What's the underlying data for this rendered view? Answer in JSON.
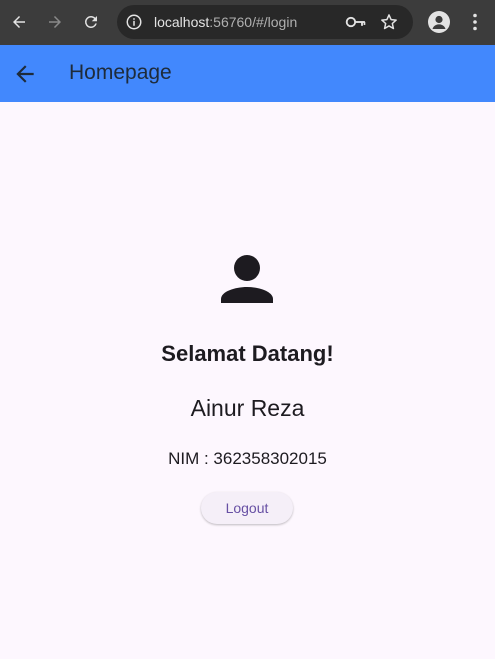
{
  "browser": {
    "url_host": "localhost",
    "url_rest": ":56760/#/login",
    "icons": {
      "back": "back-arrow-icon",
      "forward": "forward-arrow-icon",
      "reload": "reload-icon",
      "site_info": "info-icon",
      "password": "key-icon",
      "bookmark": "star-icon",
      "profile": "profile-icon",
      "menu": "more-vert-icon"
    }
  },
  "appbar": {
    "title": "Homepage",
    "back_icon": "back-arrow-icon",
    "color": "#4288fd"
  },
  "profile": {
    "icon": "person-icon",
    "welcome": "Selamat Datang!",
    "name": "Ainur Reza",
    "nim": "NIM : 362358302015"
  },
  "actions": {
    "logout_label": "Logout",
    "accent": "#6750a4"
  }
}
